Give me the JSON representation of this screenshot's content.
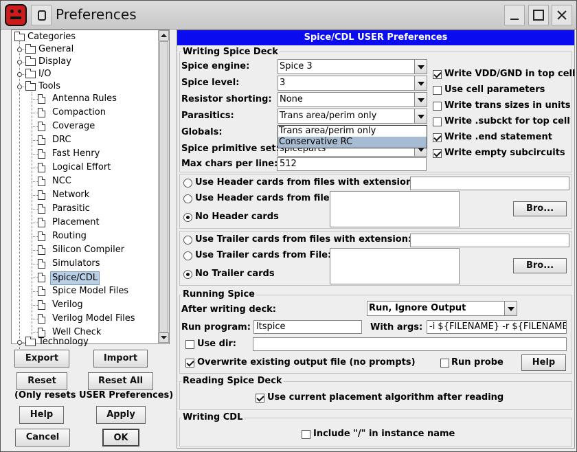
{
  "window": {
    "title": "Preferences"
  },
  "tree": {
    "root": "Categories",
    "nodes": [
      {
        "label": "General",
        "type": "folder"
      },
      {
        "label": "Display",
        "type": "folder"
      },
      {
        "label": "I/O",
        "type": "folder"
      },
      {
        "label": "Tools",
        "type": "folder"
      },
      {
        "label": "Antenna Rules",
        "type": "leaf"
      },
      {
        "label": "Compaction",
        "type": "leaf"
      },
      {
        "label": "Coverage",
        "type": "leaf"
      },
      {
        "label": "DRC",
        "type": "leaf"
      },
      {
        "label": "Fast Henry",
        "type": "leaf"
      },
      {
        "label": "Logical Effort",
        "type": "leaf"
      },
      {
        "label": "NCC",
        "type": "leaf"
      },
      {
        "label": "Network",
        "type": "leaf"
      },
      {
        "label": "Parasitic",
        "type": "leaf"
      },
      {
        "label": "Placement",
        "type": "leaf"
      },
      {
        "label": "Routing",
        "type": "leaf"
      },
      {
        "label": "Silicon Compiler",
        "type": "leaf"
      },
      {
        "label": "Simulators",
        "type": "leaf"
      },
      {
        "label": "Spice/CDL",
        "type": "leaf"
      },
      {
        "label": "Spice Model Files",
        "type": "leaf"
      },
      {
        "label": "Verilog",
        "type": "leaf"
      },
      {
        "label": "Verilog Model Files",
        "type": "leaf"
      },
      {
        "label": "Well Check",
        "type": "leaf"
      },
      {
        "label": "Technology",
        "type": "folder"
      }
    ]
  },
  "left_buttons": {
    "export": "Export",
    "import": "Import",
    "reset": "Reset",
    "reset_all": "Reset All",
    "note": "(Only resets USER Preferences)",
    "help": "Help",
    "apply": "Apply",
    "cancel": "Cancel",
    "ok": "OK"
  },
  "panel": {
    "header": "Spice/CDL USER Preferences",
    "writing_deck": {
      "title": "Writing Spice Deck",
      "engine_label": "Spice engine:",
      "engine_value": "Spice 3",
      "level_label": "Spice level:",
      "level_value": "3",
      "resistor_label": "Resistor shorting:",
      "resistor_value": "None",
      "parasitics_label": "Parasitics:",
      "parasitics_value": "Trans area/perim only",
      "parasitics_options": [
        "Trans area/perim only",
        "Conservative RC"
      ],
      "globals_label": "Globals:",
      "primitive_label": "Spice primitive set:",
      "primitive_value": "spiceparts",
      "maxchars_label": "Max chars per line:",
      "maxchars_value": "512",
      "checkboxes": [
        {
          "label": "Write VDD/GND in top cell",
          "checked": true
        },
        {
          "label": "Use cell parameters",
          "checked": false
        },
        {
          "label": "Write trans sizes in units",
          "checked": false
        },
        {
          "label": "Write .subckt for top cell",
          "checked": false
        },
        {
          "label": "Write .end statement",
          "checked": true
        },
        {
          "label": "Write empty subcircuits",
          "checked": true
        }
      ]
    },
    "header_cards": {
      "ext_label": "Use Header cards from files with extension:",
      "file_label": "Use Header cards from file:",
      "none_label": "No Header cards",
      "browse": "Bro...",
      "selected": "none"
    },
    "trailer_cards": {
      "ext_label": "Use Trailer cards from files with extension:",
      "file_label": "Use Trailer cards from File:",
      "none_label": "No Trailer cards",
      "browse": "Bro...",
      "selected": "none"
    },
    "running": {
      "title": "Running Spice",
      "after_label": "After writing deck:",
      "after_value": "Run, Ignore Output",
      "program_label": "Run program:",
      "program_value": "ltspice",
      "args_label": "With args:",
      "args_value": "-i ${FILENAME} -r ${FILENAME_N",
      "usedir_label": "Use dir:",
      "usedir_checked": false,
      "overwrite_label": "Overwrite existing output file (no prompts)",
      "overwrite_checked": true,
      "probe_label": "Run probe",
      "probe_checked": false,
      "help": "Help"
    },
    "reading": {
      "title": "Reading Spice Deck",
      "placement_label": "Use current placement algorithm after reading",
      "placement_checked": true
    },
    "cdl": {
      "title": "Writing CDL",
      "include_label": "Include \"/\" in instance name",
      "include_checked": false
    }
  }
}
